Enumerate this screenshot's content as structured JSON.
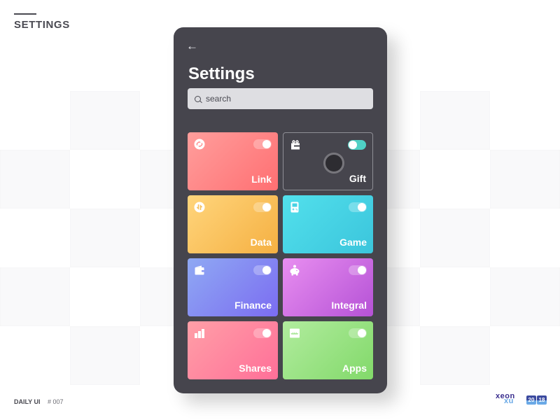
{
  "page": {
    "heading": "SETTINGS",
    "footer_label": "DAILY UI",
    "footer_number": "# 007",
    "brand": {
      "line1": "xeon",
      "line2": "xu",
      "year_parts": [
        "20",
        "18"
      ]
    }
  },
  "phone": {
    "back_icon": "arrow-left-icon",
    "back_glyph": "←",
    "title": "Settings",
    "search": {
      "placeholder": "search",
      "value": ""
    },
    "cards": [
      {
        "label": "Link",
        "icon": "link-icon",
        "enabled": true,
        "color_from": "#ff9e9c",
        "color_to": "#ff6f72"
      },
      {
        "label": "Gift",
        "icon": "gift-icon",
        "enabled": false,
        "track_color": "#4fd1c5"
      },
      {
        "label": "Data",
        "icon": "data-icon",
        "enabled": true,
        "color_from": "#ffd57c",
        "color_to": "#f5b042"
      },
      {
        "label": "Game",
        "icon": "gamepad-icon",
        "enabled": true,
        "color_from": "#52e0ec",
        "color_to": "#3bc5dc"
      },
      {
        "label": "Finance",
        "icon": "wallet-icon",
        "enabled": true,
        "color_from": "#8fa9f3",
        "color_to": "#7b6cf2"
      },
      {
        "label": "Integral",
        "icon": "piggy-bank-icon",
        "enabled": true,
        "color_from": "#e88ef0",
        "color_to": "#b552d6"
      },
      {
        "label": "Shares",
        "icon": "bar-chart-icon",
        "enabled": true,
        "color_from": "#ff9fa7",
        "color_to": "#ff6f98"
      },
      {
        "label": "Apps",
        "icon": "monitor-wave-icon",
        "enabled": true,
        "color_from": "#b1ec9e",
        "color_to": "#82d96a"
      }
    ]
  }
}
